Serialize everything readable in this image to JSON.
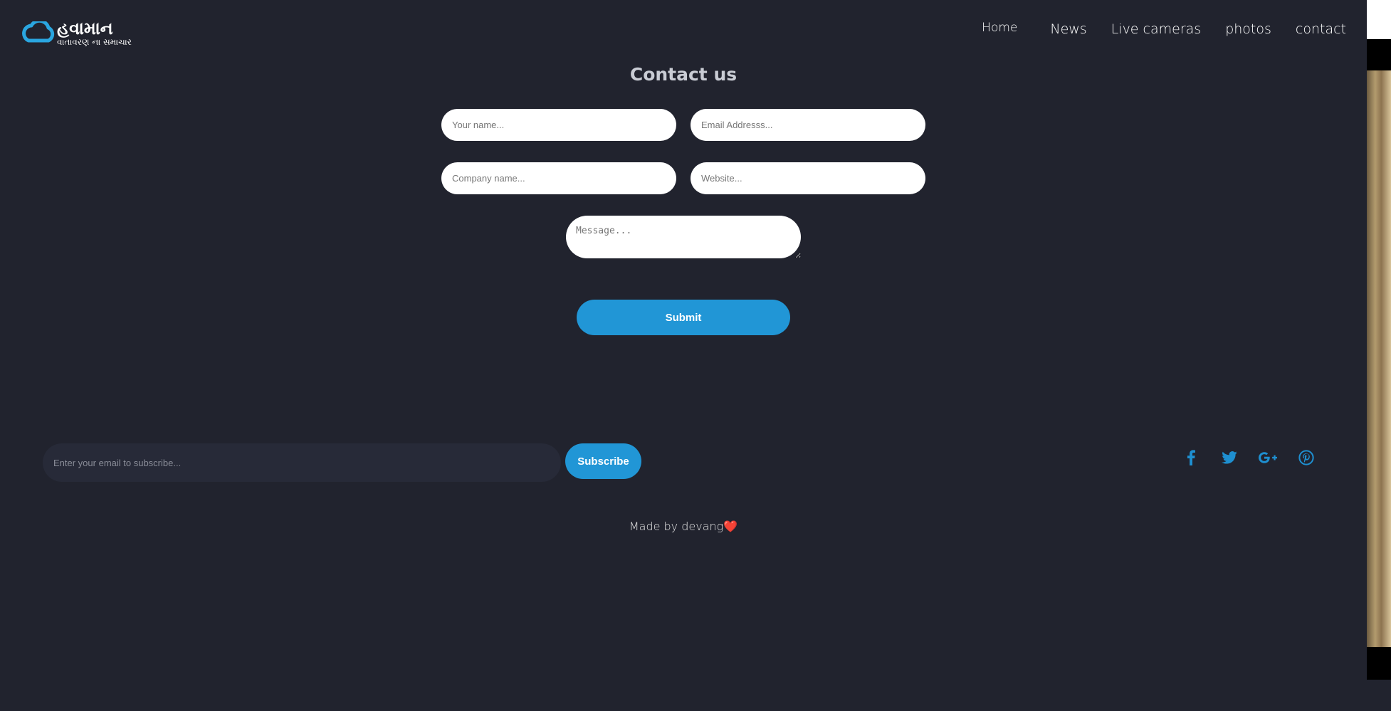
{
  "header": {
    "logo_title": "હવામાન",
    "logo_tagline": "વાતાવરણ ના સમાચાર",
    "nav": [
      {
        "label": "Home"
      },
      {
        "label": "News"
      },
      {
        "label": "Live cameras"
      },
      {
        "label": "photos"
      },
      {
        "label": "contact"
      }
    ]
  },
  "contact": {
    "title": "Contact us",
    "name_placeholder": "Your name...",
    "email_placeholder": "Email Addresss...",
    "company_placeholder": "Company name...",
    "website_placeholder": "Website...",
    "message_placeholder": "Message...",
    "submit_label": "Submit"
  },
  "footer": {
    "subscribe_placeholder": "Enter your email to subscribe...",
    "subscribe_label": "Subscribe",
    "social": [
      "facebook-icon",
      "twitter-icon",
      "google-plus-icon",
      "pinterest-icon"
    ],
    "credit_text": "Made by devang",
    "credit_heart": "❤️"
  },
  "colors": {
    "background": "#21232e",
    "accent": "#2196d6"
  }
}
